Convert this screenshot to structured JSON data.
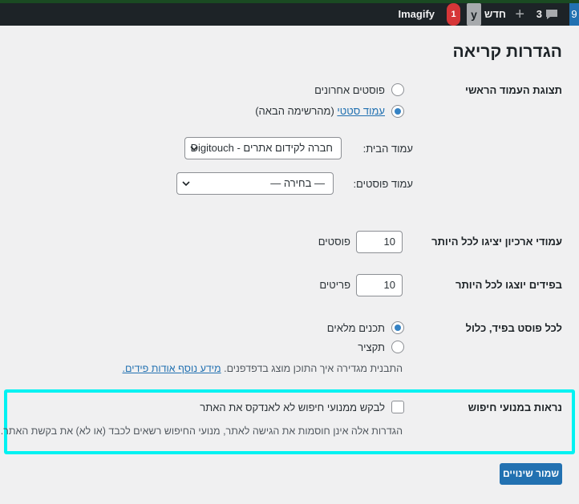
{
  "admin_bar": {
    "edge_item": "9",
    "comments_count": "3",
    "new_label": "חדש",
    "yoast_logo": "y",
    "notification_badge": "1",
    "imagify_label": "Imagify"
  },
  "page_title": "הגדרות קריאה",
  "front_page": {
    "label": "תצוגת העמוד הראשי",
    "option_latest": "פוסטים אחרונים",
    "option_static_link": "עמוד סטטי",
    "option_static_note": "(מהרשימה הבאה)",
    "homepage_label": "עמוד הבית:",
    "homepage_value": "חברה לקידום אתרים - Digitouch",
    "posts_page_label": "עמוד פוסטים:",
    "posts_page_value": "— בחירה —"
  },
  "blog_pages": {
    "label": "עמודי ארכיון יציגו לכל היותר",
    "value": "10",
    "unit": "פוסטים"
  },
  "feed_items": {
    "label": "בפידים יוצגו לכל היותר",
    "value": "10",
    "unit": "פריטים"
  },
  "feed_content": {
    "label": "לכל פוסט בפיד, כלול",
    "option_full": "תכנים מלאים",
    "option_excerpt": "תקציר",
    "description_text": "התבנית מגדירה איך התוכן מוצג בדפדפנים.",
    "description_link": "מידע נוסף אודות פידים."
  },
  "search_visibility": {
    "label": "נראות במנועי חיפוש",
    "checkbox_label": "לבקש ממנועי חיפוש לא לאנדקס את האתר",
    "description": "הגדרות אלה אינן חוסמות את הגישה לאתר, מנועי החיפוש רשאים לכבד (או לא) את בקשת האתר."
  },
  "save_button": "שמור שינויים",
  "colors": {
    "accent": "#2271b1",
    "highlight": "#00f2f2",
    "admin_bar": "#1d2327",
    "background": "#f0f0f1"
  }
}
